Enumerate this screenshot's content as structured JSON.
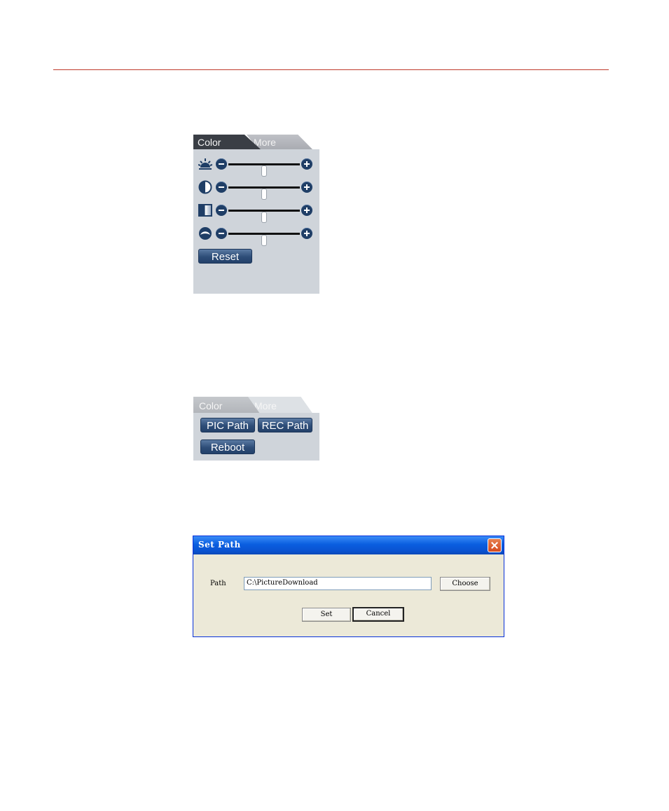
{
  "color_panel": {
    "tabs": [
      {
        "label": "Color",
        "active": true
      },
      {
        "label": "More",
        "active": false
      }
    ],
    "sliders": [
      {
        "name": "brightness",
        "icon": "brightness-icon",
        "value": 0.5
      },
      {
        "name": "contrast",
        "icon": "contrast-icon",
        "value": 0.5
      },
      {
        "name": "saturation",
        "icon": "saturation-icon",
        "value": 0.5
      },
      {
        "name": "hue",
        "icon": "hue-icon",
        "value": 0.5
      }
    ],
    "reset_label": "Reset"
  },
  "more_panel": {
    "tabs": [
      {
        "label": "Color",
        "active": false
      },
      {
        "label": "More",
        "active": true
      }
    ],
    "pic_path_label": "PIC Path",
    "rec_path_label": "REC Path",
    "reboot_label": "Reboot"
  },
  "set_path_dialog": {
    "title": "Set Path",
    "path_label": "Path",
    "path_value": "C:\\PictureDownload",
    "choose_label": "Choose",
    "set_label": "Set",
    "cancel_label": "Cancel"
  },
  "colors": {
    "accent_rule": "#c0392b",
    "button_blue": "#2e4d78",
    "panel_bg": "#cfd4da",
    "dialog_bg": "#ece9d8",
    "titlebar_blue": "#0a5ee0"
  }
}
